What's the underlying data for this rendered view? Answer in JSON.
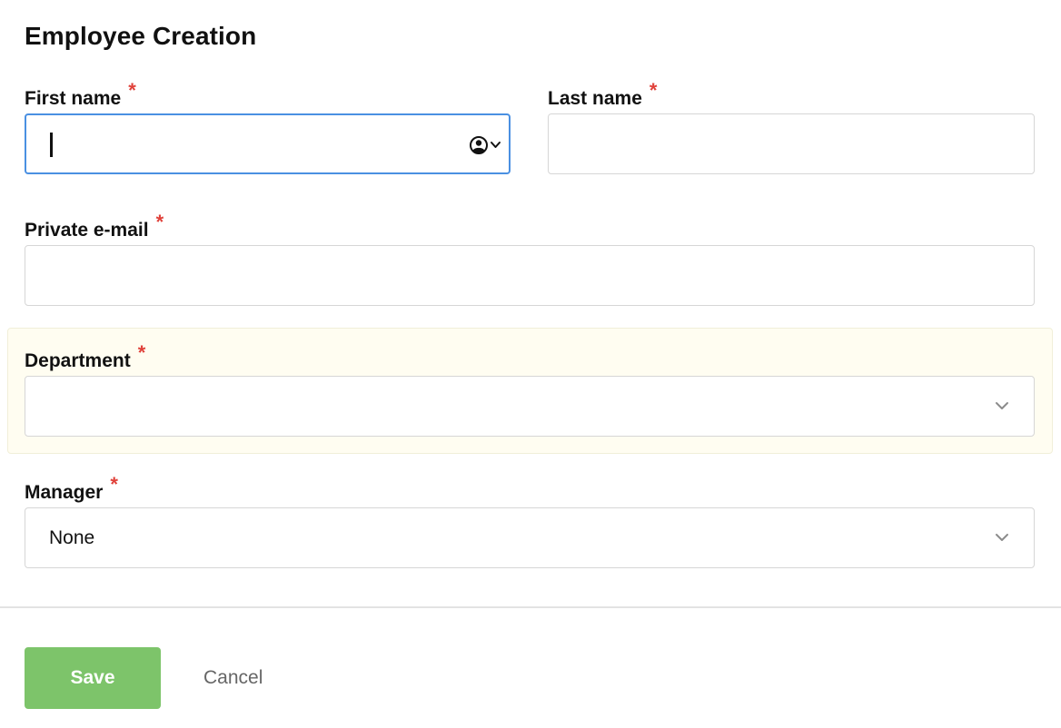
{
  "form": {
    "title": "Employee Creation",
    "required_marker": "*",
    "first_name": {
      "label": "First name",
      "value": "",
      "placeholder": ""
    },
    "last_name": {
      "label": "Last name",
      "value": "",
      "placeholder": ""
    },
    "private_email": {
      "label": "Private e-mail",
      "value": "",
      "placeholder": ""
    },
    "department": {
      "label": "Department",
      "selected": ""
    },
    "manager": {
      "label": "Manager",
      "selected": "None"
    }
  },
  "actions": {
    "save_label": "Save",
    "cancel_label": "Cancel"
  },
  "icons": {
    "contact_picker": "person-circle-icon",
    "select_arrow": "chevron-down-icon"
  },
  "colors": {
    "accent": "#4a90e2",
    "required": "#e0413a",
    "save": "#7dc46a",
    "highlight_panel": "#fffdf1"
  }
}
